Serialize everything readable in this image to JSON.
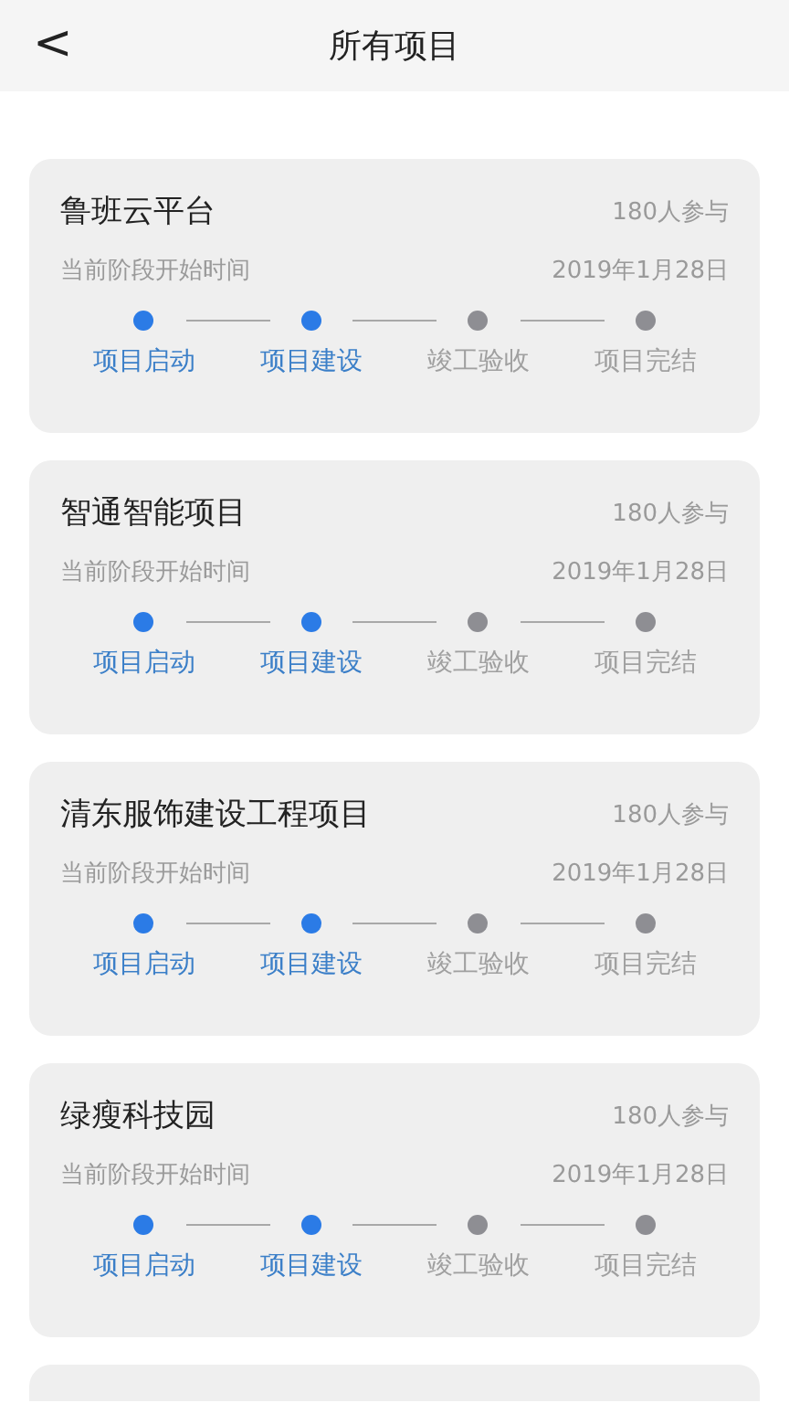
{
  "header": {
    "title": "所有项目",
    "back": "<"
  },
  "projects": [
    {
      "kind": "full",
      "name": "鲁班云平台",
      "participants": "180人参与",
      "stage_label": "当前阶段开始时间",
      "stage_date": "2019年1月28日",
      "steps": [
        {
          "label": "项目启动",
          "reached": true
        },
        {
          "label": "项目建设",
          "reached": true
        },
        {
          "label": "竣工验收",
          "reached": false
        },
        {
          "label": "项目完结",
          "reached": false
        }
      ]
    },
    {
      "kind": "full",
      "name": "智通智能项目",
      "participants": "180人参与",
      "stage_label": "当前阶段开始时间",
      "stage_date": "2019年1月28日",
      "steps": [
        {
          "label": "项目启动",
          "reached": true
        },
        {
          "label": "项目建设",
          "reached": true
        },
        {
          "label": "竣工验收",
          "reached": false
        },
        {
          "label": "项目完结",
          "reached": false
        }
      ]
    },
    {
      "kind": "full",
      "name": "清东服饰建设工程项目",
      "participants": "180人参与",
      "stage_label": "当前阶段开始时间",
      "stage_date": "2019年1月28日",
      "steps": [
        {
          "label": "项目启动",
          "reached": true
        },
        {
          "label": "项目建设",
          "reached": true
        },
        {
          "label": "竣工验收",
          "reached": false
        },
        {
          "label": "项目完结",
          "reached": false
        }
      ]
    },
    {
      "kind": "full",
      "name": "绿瘦科技园",
      "participants": "180人参与",
      "stage_label": "当前阶段开始时间",
      "stage_date": "2019年1月28日",
      "steps": [
        {
          "label": "项目启动",
          "reached": true
        },
        {
          "label": "项目建设",
          "reached": true
        },
        {
          "label": "竣工验收",
          "reached": false
        },
        {
          "label": "项目完结",
          "reached": false
        }
      ]
    },
    {
      "kind": "partial"
    }
  ]
}
